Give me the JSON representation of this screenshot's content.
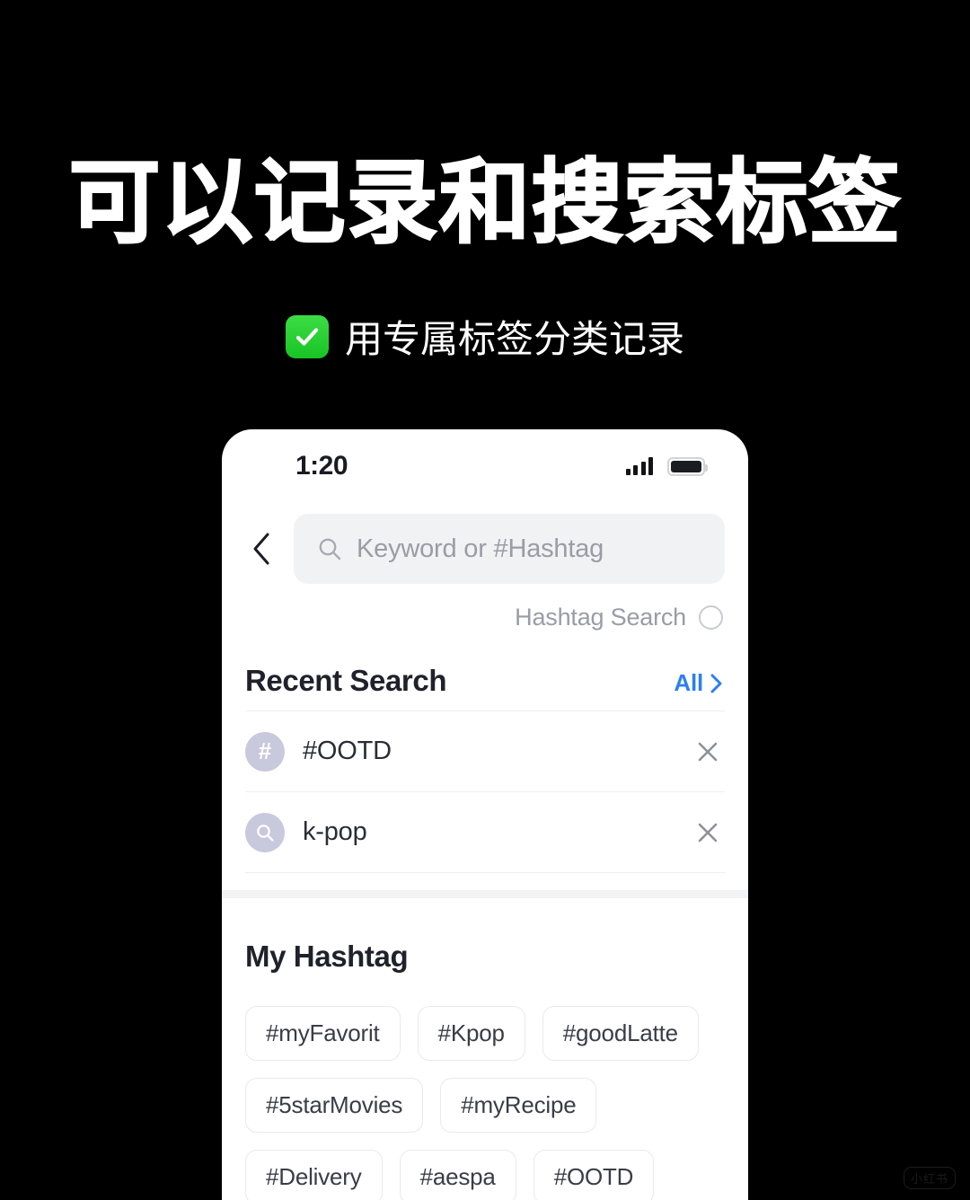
{
  "poster": {
    "headline": "可以记录和搜索标签",
    "subtitle": "用专属标签分类记录",
    "check_icon": "white-check-mark-emoji",
    "background_color": "#000000",
    "text_color": "#FFFFFF",
    "check_color": "#2FD236"
  },
  "watermark": {
    "text": "小红书"
  },
  "phone": {
    "status_bar": {
      "time": "1:20",
      "signal_icon": "signal-bars-icon",
      "battery_icon": "battery-full-icon"
    },
    "top_bar": {
      "back_icon": "chevron-left-icon",
      "search": {
        "icon": "search-icon",
        "placeholder": "Keyword or #Hashtag",
        "value": ""
      },
      "hashtag_search": {
        "label": "Hashtag Search",
        "checked": false,
        "icon": "radio-unchecked-icon"
      }
    },
    "recent_search": {
      "title": "Recent Search",
      "all_label": "All",
      "all_chevron_icon": "chevron-right-icon",
      "all_color": "#2D7FF0",
      "items": [
        {
          "icon": "hashtag-icon",
          "glyph": "#",
          "label": "#OOTD",
          "close_icon": "close-icon"
        },
        {
          "icon": "search-icon",
          "glyph": "",
          "label": "k-pop",
          "close_icon": "close-icon"
        }
      ]
    },
    "my_hashtag": {
      "title": "My Hashtag",
      "chips": [
        "#myFavorit",
        "#Kpop",
        "#goodLatte",
        "#5starMovies",
        "#myRecipe",
        "#Delivery",
        "#aespa",
        "#OOTD"
      ]
    }
  }
}
